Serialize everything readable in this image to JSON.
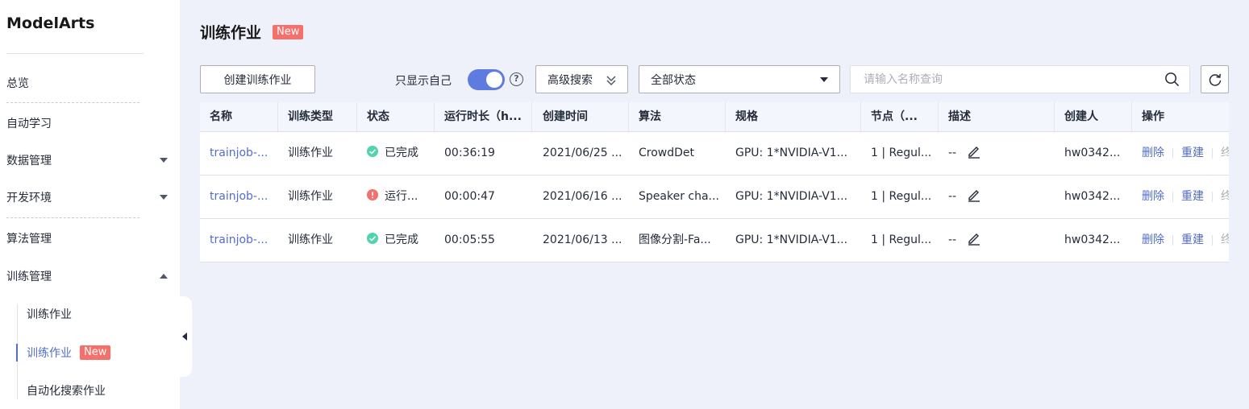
{
  "sidebar": {
    "brand": "ModelArts",
    "items": [
      {
        "label": "总览"
      },
      {
        "label": "自动学习"
      },
      {
        "label": "数据管理"
      },
      {
        "label": "开发环境"
      },
      {
        "label": "算法管理"
      },
      {
        "label": "训练管理"
      }
    ],
    "sub_items": [
      {
        "label": "训练作业"
      },
      {
        "label": "训练作业",
        "badge": "New"
      },
      {
        "label": "自动化搜索作业"
      }
    ]
  },
  "main": {
    "title": "训练作业",
    "title_badge": "New",
    "toolbar": {
      "create_label": "创建训练作业",
      "only_self_label": "只显示自己",
      "only_self_on": true,
      "advanced_search_label": "高级搜索",
      "status_select_value": "全部状态",
      "search_placeholder": "请输入名称查询"
    },
    "table": {
      "headers": [
        "名称",
        "训练类型",
        "状态",
        "运行时长（h...",
        "创建时间",
        "算法",
        "规格",
        "节点（...",
        "描述",
        "创建人",
        "操作"
      ],
      "rows": [
        {
          "name": "trainjob-...",
          "type": "训练作业",
          "status": "已完成",
          "status_kind": "done",
          "duration": "00:36:19",
          "created": "2021/06/25 ...",
          "algorithm": "CrowdDet",
          "spec": "GPU: 1*NVIDIA-V1...",
          "node": "1 | Regul...",
          "desc": "--",
          "creator": "hw0342...",
          "op_delete": "删除",
          "op_rebuild": "重建",
          "op_more": "终"
        },
        {
          "name": "trainjob-...",
          "type": "训练作业",
          "status": "运行...",
          "status_kind": "error",
          "duration": "00:00:47",
          "created": "2021/06/16 ...",
          "algorithm": "Speaker cha...",
          "spec": "GPU: 1*NVIDIA-V1...",
          "node": "1 | Regul...",
          "desc": "--",
          "creator": "hw0342...",
          "op_delete": "删除",
          "op_rebuild": "重建",
          "op_more": "终"
        },
        {
          "name": "trainjob-...",
          "type": "训练作业",
          "status": "已完成",
          "status_kind": "done",
          "duration": "00:05:55",
          "created": "2021/06/13 ...",
          "algorithm": "图像分割-Fa...",
          "spec": "GPU: 1*NVIDIA-V1...",
          "node": "1 | Regul...",
          "desc": "--",
          "creator": "hw0342...",
          "op_delete": "删除",
          "op_rebuild": "重建",
          "op_more": "终"
        }
      ]
    }
  },
  "colors": {
    "accent": "#526ecc",
    "toggle": "#5e7ce0",
    "badge": "#f66f6a",
    "success": "#50d4ab",
    "error": "#f66f6a",
    "background": "#eef1fa"
  }
}
